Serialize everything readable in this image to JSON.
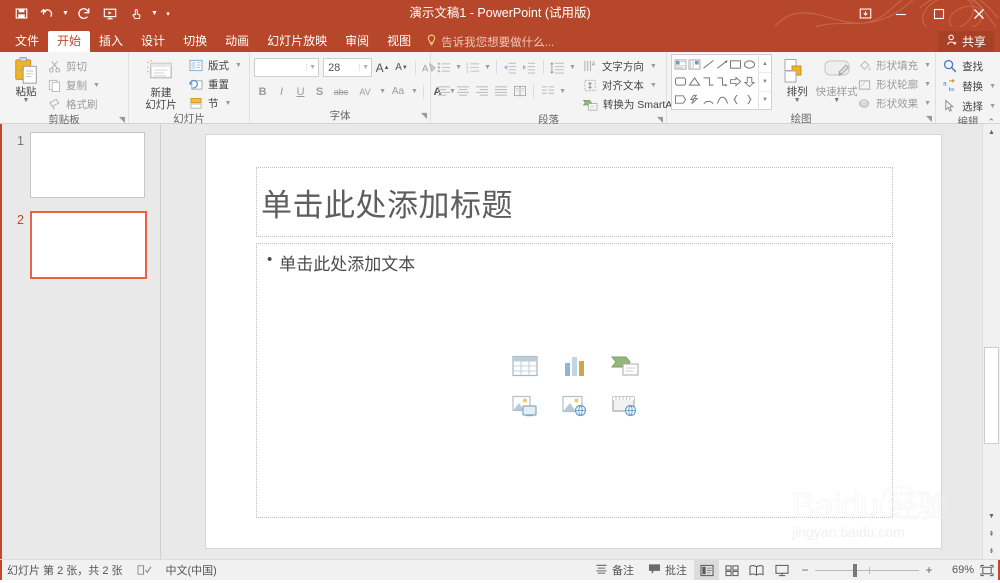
{
  "titlebar": {
    "title": "演示文稿1 - PowerPoint (试用版)",
    "qat": [
      {
        "name": "save-icon",
        "label": "保存"
      },
      {
        "name": "undo-icon",
        "label": "撤消"
      },
      {
        "name": "redo-icon",
        "label": "恢复"
      },
      {
        "name": "start-slideshow-icon",
        "label": "从头开始"
      },
      {
        "name": "touch-mouse-mode-icon",
        "label": "触摸/鼠标模式"
      },
      {
        "name": "customize-qat-icon",
        "label": "自定义快速访问工具栏"
      }
    ],
    "ribbon_display_label": "功能区显示选项",
    "minimize_label": "最小化",
    "maximize_label": "最大化",
    "close_label": "关闭"
  },
  "tabs": [
    {
      "label": "文件",
      "active": false
    },
    {
      "label": "开始",
      "active": true
    },
    {
      "label": "插入",
      "active": false
    },
    {
      "label": "设计",
      "active": false
    },
    {
      "label": "切换",
      "active": false
    },
    {
      "label": "动画",
      "active": false
    },
    {
      "label": "幻灯片放映",
      "active": false
    },
    {
      "label": "审阅",
      "active": false
    },
    {
      "label": "视图",
      "active": false
    }
  ],
  "tellme": "告诉我您想要做什么...",
  "share": "共享",
  "ribbon": {
    "clipboard": {
      "group_label": "剪贴板",
      "paste": "粘贴",
      "cut": "剪切",
      "copy": "复制",
      "format_painter": "格式刷"
    },
    "slides": {
      "group_label": "幻灯片",
      "new_slide": "新建\n幻灯片",
      "new_slide_line1": "新建",
      "new_slide_line2": "幻灯片",
      "layout": "版式",
      "reset": "重置",
      "section": "节"
    },
    "font": {
      "group_label": "字体",
      "font_name_value": "",
      "font_name_placeholder": "",
      "font_size_value": "28",
      "grow_font": "A",
      "shrink_font": "A",
      "clear_formatting": "清除所有格式",
      "bold": "B",
      "italic": "I",
      "underline": "U",
      "shadow": "S",
      "strikethrough": "abc",
      "character_spacing": "AV",
      "change_case": "Aa",
      "font_color": "A"
    },
    "paragraph": {
      "group_label": "段落",
      "text_direction": "文字方向",
      "align_text": "对齐文本",
      "convert_smartart": "转换为 SmartArt"
    },
    "drawing": {
      "group_label": "绘图",
      "arrange": "排列",
      "quick_styles": "快速样式",
      "shape_fill": "形状填充",
      "shape_outline": "形状轮廓",
      "shape_effects": "形状效果"
    },
    "editing": {
      "group_label": "编辑",
      "find": "查找",
      "replace": "替换",
      "select": "选择"
    },
    "collapse_ribbon_label": "折叠功能区"
  },
  "thumbnails": [
    {
      "number": "1",
      "selected": false
    },
    {
      "number": "2",
      "selected": true
    }
  ],
  "slide": {
    "title_placeholder": "单击此处添加标题",
    "body_bullet": "单击此处添加文本",
    "bullet_char": "•",
    "insert_icons": [
      {
        "name": "insert-table-icon",
        "label": "插入表格"
      },
      {
        "name": "insert-chart-icon",
        "label": "插入图表"
      },
      {
        "name": "insert-smartart-icon",
        "label": "插入 SmartArt 图形"
      },
      {
        "name": "insert-3d-model-icon",
        "label": "插入 3D 模型"
      },
      {
        "name": "insert-online-picture-icon",
        "label": "联机图片"
      },
      {
        "name": "insert-video-icon",
        "label": "插入视频"
      }
    ]
  },
  "watermark": {
    "brand": "Baidu",
    "brand_cn": "经验",
    "url": "jingyan.baidu.com"
  },
  "statusbar": {
    "slide_count": "幻灯片 第 2 张，共 2 张",
    "accessibility_icon": "spell-check-icon",
    "language": "中文(中国)",
    "notes": "备注",
    "comments": "批注",
    "views": [
      {
        "name": "view-normal",
        "label": "普通视图",
        "active": true
      },
      {
        "name": "view-slide-sorter",
        "label": "幻灯片浏览",
        "active": false
      },
      {
        "name": "view-reading",
        "label": "阅读视图",
        "active": false
      },
      {
        "name": "view-slideshow",
        "label": "幻灯片放映",
        "active": false
      }
    ],
    "zoom_out": "−",
    "zoom_in": "+",
    "zoom_value": "69%",
    "fit_label": "使幻灯片适应当前窗口"
  },
  "colors": {
    "brand": "#b7472a",
    "accent_tab_text": "#c0492b",
    "selection": "#e8633f",
    "ribbon_bg": "#f4f4f4",
    "canvas_bg": "#e9e9e9"
  }
}
